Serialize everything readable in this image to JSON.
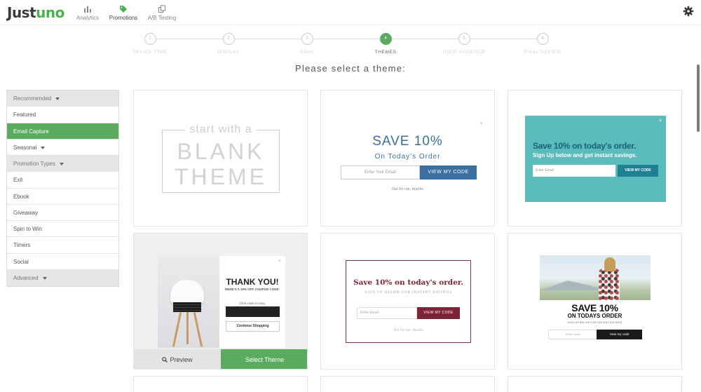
{
  "app": {
    "logo_text": "Justuno",
    "accent": "#5aab60"
  },
  "nav": [
    {
      "label": "Analytics",
      "icon": "bar-chart-icon"
    },
    {
      "label": "Promotions",
      "icon": "tag-icon"
    },
    {
      "label": "A/B Testing",
      "icon": "copy-icon"
    }
  ],
  "settings_icon": "gear-icon",
  "stepper": {
    "steps": [
      {
        "num": "1",
        "label": "Device Type"
      },
      {
        "num": "2",
        "label": "Display"
      },
      {
        "num": "3",
        "label": "Goal"
      },
      {
        "num": "4",
        "label": "Themes"
      },
      {
        "num": "5",
        "label": "User Audience"
      },
      {
        "num": "6",
        "label": "Final Review"
      }
    ],
    "active_step": 4
  },
  "heading": "Please select a theme:",
  "sidebar": {
    "items": [
      {
        "label": "Recommended",
        "type": "header",
        "caret": true
      },
      {
        "label": "Featured",
        "type": "item"
      },
      {
        "label": "Email Capture",
        "type": "item",
        "active": true
      },
      {
        "label": "Seasonal",
        "type": "item",
        "caret": true
      },
      {
        "label": "Promotion Types",
        "type": "header",
        "caret": true
      },
      {
        "label": "Exit",
        "type": "item"
      },
      {
        "label": "Ebook",
        "type": "item"
      },
      {
        "label": "Giveaway",
        "type": "item"
      },
      {
        "label": "Spin to Win",
        "type": "item"
      },
      {
        "label": "Timers",
        "type": "item"
      },
      {
        "label": "Social",
        "type": "item"
      },
      {
        "label": "Advanced",
        "type": "header",
        "caret": true
      }
    ]
  },
  "themes": {
    "blank": {
      "line1": "start with a",
      "line2": "BLANK",
      "line3": "THEME"
    },
    "blue": {
      "close": "×",
      "title": "SAVE 10%",
      "subtitle": "On Today's Order",
      "input_placeholder": "Enter Your Email",
      "button": "VIEW MY CODE",
      "decline": "Not for me, thanks"
    },
    "teal": {
      "close": "×",
      "title": "Save 10% on today's order.",
      "subtitle": "Sign Up below and get instant savings.",
      "input_placeholder": "Enter Email",
      "button": "VIEW MY CODE"
    },
    "thankyou": {
      "close": "×",
      "title": "THANK YOU!",
      "subtitle": "HERE'S A 10% OFF COUPON CODE:",
      "hint": "Click code to copy.",
      "button": "Continue Shopping",
      "preview_label": "Preview",
      "select_label": "Select Theme"
    },
    "maroon": {
      "title": "Save 10% on today's order.",
      "subtitle": "SIGN UP BELOW FOR INSTANT SAVINGS",
      "input_placeholder": "Enter Email",
      "button": "VIEW MY CODE",
      "decline": "Not for me, thanks"
    },
    "photo": {
      "title": "SAVE 10%",
      "subtitle": "ON TODAYS ORDER",
      "small": "SIGN UP BELOW FOR INSTANT SAVINGS",
      "input_placeholder": "Enter Email",
      "button": "View my code"
    }
  }
}
